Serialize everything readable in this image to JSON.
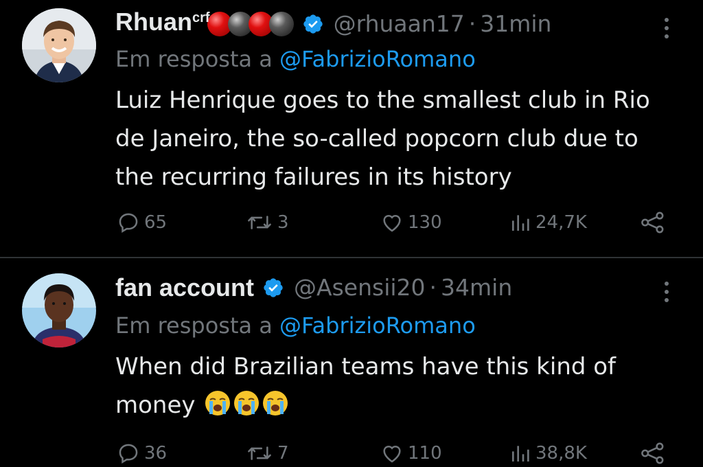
{
  "tweets": [
    {
      "author": {
        "display_name": "Rhuan",
        "name_superscript": "crf",
        "name_balls": [
          "red",
          "black",
          "red",
          "black"
        ],
        "verified": true,
        "handle": "@rhuaan17",
        "separator": "·",
        "time": "31min"
      },
      "reply_prefix": "Em resposta a",
      "reply_mention": "@FabrizioRomano",
      "text_lines": [
        "Luiz Henrique goes to the smallest club in Rio",
        "de Janeiro, the so-called popcorn club due to",
        "the recurring failures in its history"
      ],
      "emoji_count": 0,
      "stats": {
        "replies": "65",
        "reposts": "3",
        "likes": "130",
        "views": "24,7K"
      }
    },
    {
      "author": {
        "display_name": "fan account",
        "verified": true,
        "handle": "@Asensii20",
        "separator": "·",
        "time": "34min"
      },
      "reply_prefix": "Em resposta a",
      "reply_mention": "@FabrizioRomano",
      "text_lines": [
        "When did Brazilian teams have this kind of",
        "money"
      ],
      "emoji": "loudly-crying-face",
      "emoji_count": 3,
      "stats": {
        "replies": "36",
        "reposts": "7",
        "likes": "110",
        "views": "38,8K"
      }
    }
  ],
  "icons": {
    "more": "more-vertical-icon",
    "reply": "reply-icon",
    "repost": "repost-icon",
    "like": "like-icon",
    "views": "views-icon",
    "share": "share-icon",
    "verified": "verified-badge-icon"
  },
  "colors": {
    "background": "#000000",
    "text": "#e7e9ea",
    "muted": "#71767b",
    "accent": "#1d9bf0",
    "divider": "#2f3336"
  }
}
